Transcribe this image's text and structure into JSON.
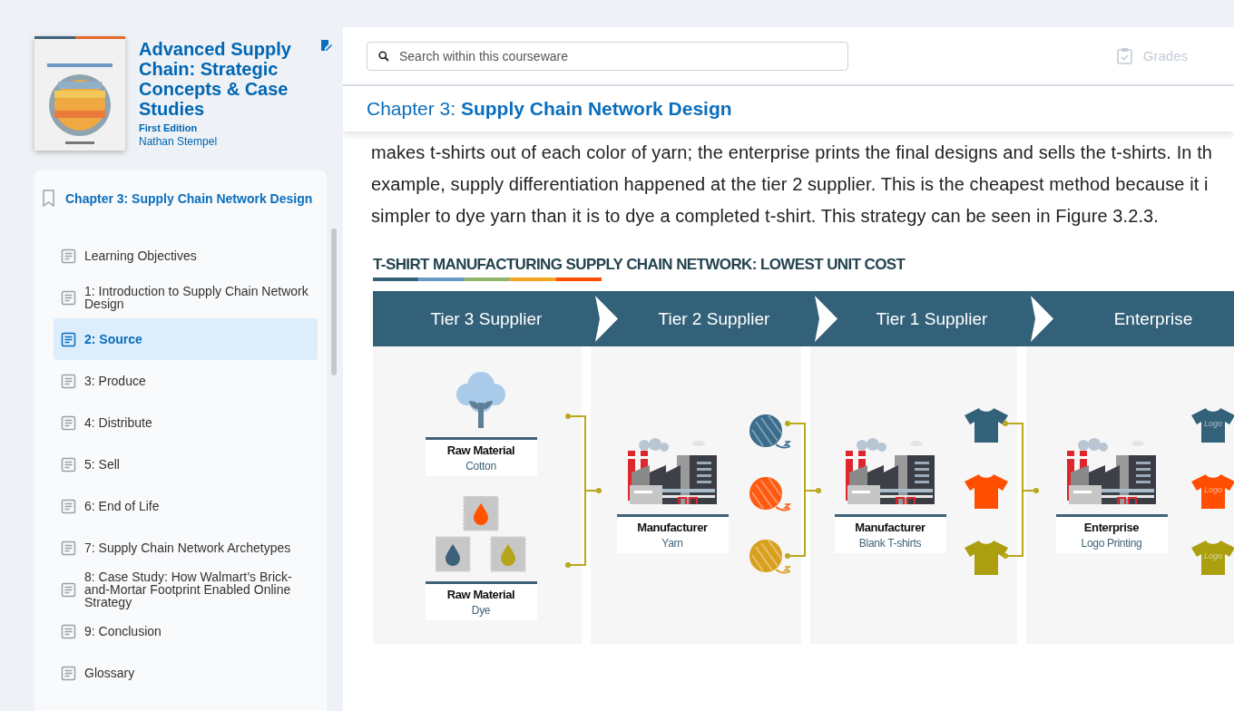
{
  "book": {
    "title": "Advanced Supply Chain: Strategic Concepts & Case Studies",
    "edition": "First Edition",
    "author": "Nathan Stempel"
  },
  "toc": {
    "chapter": "Chapter 3: Supply Chain Network Design",
    "items": [
      {
        "label": "Learning Objectives",
        "selected": false
      },
      {
        "label": "1: Introduction to Supply Chain Network Design",
        "selected": false
      },
      {
        "label": "2: Source",
        "selected": true
      },
      {
        "label": "3: Produce",
        "selected": false
      },
      {
        "label": "4: Distribute",
        "selected": false
      },
      {
        "label": "5: Sell",
        "selected": false
      },
      {
        "label": "6: End of Life",
        "selected": false
      },
      {
        "label": "7: Supply Chain Network Archetypes",
        "selected": false
      },
      {
        "label": "8: Case Study: How Walmart’s Brick-and-Mortar Footprint Enabled Online Strategy",
        "selected": false
      },
      {
        "label": "9: Conclusion",
        "selected": false
      },
      {
        "label": "Glossary",
        "selected": false
      }
    ]
  },
  "search": {
    "placeholder": "Search within this courseware"
  },
  "grades": {
    "label": "Grades",
    "disabled": true
  },
  "chapter_heading": "Chapter 3: **Supply Chain Network Design**",
  "paragraph_lines": [
    "makes t-shirts out of each color of yarn; the enterprise prints the final designs and sells the t-shirts. In th",
    "example, supply differentiation happened at the tier 2 supplier. This is the cheapest method because it i",
    "simpler to dye yarn than it is to dye a completed t-shirt. This strategy can be seen in Figure 3.2.3."
  ],
  "infographic": {
    "title": "T-SHIRT MANUFACTURING SUPPLY CHAIN NETWORK: LOWEST UNIT COST",
    "columns": [
      {
        "tier": "Tier 3 Supplier",
        "nodes": [
          {
            "kind": "cotton",
            "title": "Raw Material",
            "subtitle": "Cotton"
          },
          {
            "kind": "dye",
            "title": "Raw Material",
            "subtitle": "Dye"
          }
        ]
      },
      {
        "tier": "Tier 2 Supplier",
        "nodes": [
          {
            "kind": "factory",
            "title": "Manufacturer",
            "subtitle": "Yarn"
          }
        ],
        "outputs": [
          {
            "kind": "yarn",
            "color": "#3a6c8c"
          },
          {
            "kind": "yarn",
            "color": "#ff5a10"
          },
          {
            "kind": "yarn",
            "color": "#d9a020"
          }
        ]
      },
      {
        "tier": "Tier 1 Supplier",
        "nodes": [
          {
            "kind": "factory",
            "title": "Manufacturer",
            "subtitle": "Blank T-shirts"
          }
        ],
        "outputs": [
          {
            "kind": "shirt",
            "color": "#336179"
          },
          {
            "kind": "shirt",
            "color": "#ff4e00"
          },
          {
            "kind": "shirt",
            "color": "#ab9f10"
          }
        ]
      },
      {
        "tier": "Enterprise",
        "nodes": [
          {
            "kind": "factory",
            "title": "Enterprise",
            "subtitle": "Logo Printing"
          }
        ],
        "outputs": [
          {
            "kind": "shirt",
            "color": "#336179",
            "print": "Logo"
          },
          {
            "kind": "shirt",
            "color": "#ff4e00",
            "print": "Logo"
          },
          {
            "kind": "shirt",
            "color": "#ab9f10",
            "print": "Logo"
          }
        ]
      }
    ]
  }
}
